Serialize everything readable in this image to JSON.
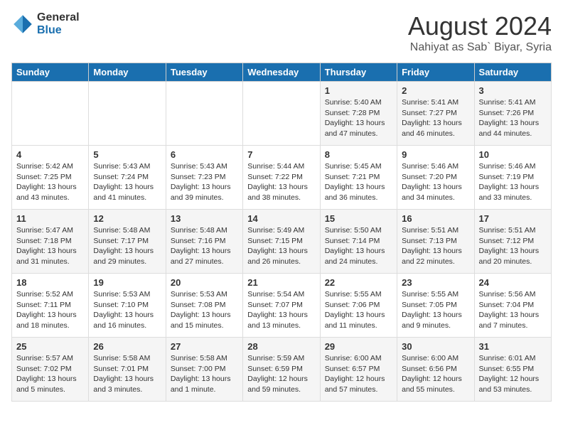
{
  "header": {
    "logo_general": "General",
    "logo_blue": "Blue",
    "month_title": "August 2024",
    "location": "Nahiyat as Sab` Biyar, Syria"
  },
  "weekdays": [
    "Sunday",
    "Monday",
    "Tuesday",
    "Wednesday",
    "Thursday",
    "Friday",
    "Saturday"
  ],
  "weeks": [
    [
      {
        "day": "",
        "info": ""
      },
      {
        "day": "",
        "info": ""
      },
      {
        "day": "",
        "info": ""
      },
      {
        "day": "",
        "info": ""
      },
      {
        "day": "1",
        "info": "Sunrise: 5:40 AM\nSunset: 7:28 PM\nDaylight: 13 hours\nand 47 minutes."
      },
      {
        "day": "2",
        "info": "Sunrise: 5:41 AM\nSunset: 7:27 PM\nDaylight: 13 hours\nand 46 minutes."
      },
      {
        "day": "3",
        "info": "Sunrise: 5:41 AM\nSunset: 7:26 PM\nDaylight: 13 hours\nand 44 minutes."
      }
    ],
    [
      {
        "day": "4",
        "info": "Sunrise: 5:42 AM\nSunset: 7:25 PM\nDaylight: 13 hours\nand 43 minutes."
      },
      {
        "day": "5",
        "info": "Sunrise: 5:43 AM\nSunset: 7:24 PM\nDaylight: 13 hours\nand 41 minutes."
      },
      {
        "day": "6",
        "info": "Sunrise: 5:43 AM\nSunset: 7:23 PM\nDaylight: 13 hours\nand 39 minutes."
      },
      {
        "day": "7",
        "info": "Sunrise: 5:44 AM\nSunset: 7:22 PM\nDaylight: 13 hours\nand 38 minutes."
      },
      {
        "day": "8",
        "info": "Sunrise: 5:45 AM\nSunset: 7:21 PM\nDaylight: 13 hours\nand 36 minutes."
      },
      {
        "day": "9",
        "info": "Sunrise: 5:46 AM\nSunset: 7:20 PM\nDaylight: 13 hours\nand 34 minutes."
      },
      {
        "day": "10",
        "info": "Sunrise: 5:46 AM\nSunset: 7:19 PM\nDaylight: 13 hours\nand 33 minutes."
      }
    ],
    [
      {
        "day": "11",
        "info": "Sunrise: 5:47 AM\nSunset: 7:18 PM\nDaylight: 13 hours\nand 31 minutes."
      },
      {
        "day": "12",
        "info": "Sunrise: 5:48 AM\nSunset: 7:17 PM\nDaylight: 13 hours\nand 29 minutes."
      },
      {
        "day": "13",
        "info": "Sunrise: 5:48 AM\nSunset: 7:16 PM\nDaylight: 13 hours\nand 27 minutes."
      },
      {
        "day": "14",
        "info": "Sunrise: 5:49 AM\nSunset: 7:15 PM\nDaylight: 13 hours\nand 26 minutes."
      },
      {
        "day": "15",
        "info": "Sunrise: 5:50 AM\nSunset: 7:14 PM\nDaylight: 13 hours\nand 24 minutes."
      },
      {
        "day": "16",
        "info": "Sunrise: 5:51 AM\nSunset: 7:13 PM\nDaylight: 13 hours\nand 22 minutes."
      },
      {
        "day": "17",
        "info": "Sunrise: 5:51 AM\nSunset: 7:12 PM\nDaylight: 13 hours\nand 20 minutes."
      }
    ],
    [
      {
        "day": "18",
        "info": "Sunrise: 5:52 AM\nSunset: 7:11 PM\nDaylight: 13 hours\nand 18 minutes."
      },
      {
        "day": "19",
        "info": "Sunrise: 5:53 AM\nSunset: 7:10 PM\nDaylight: 13 hours\nand 16 minutes."
      },
      {
        "day": "20",
        "info": "Sunrise: 5:53 AM\nSunset: 7:08 PM\nDaylight: 13 hours\nand 15 minutes."
      },
      {
        "day": "21",
        "info": "Sunrise: 5:54 AM\nSunset: 7:07 PM\nDaylight: 13 hours\nand 13 minutes."
      },
      {
        "day": "22",
        "info": "Sunrise: 5:55 AM\nSunset: 7:06 PM\nDaylight: 13 hours\nand 11 minutes."
      },
      {
        "day": "23",
        "info": "Sunrise: 5:55 AM\nSunset: 7:05 PM\nDaylight: 13 hours\nand 9 minutes."
      },
      {
        "day": "24",
        "info": "Sunrise: 5:56 AM\nSunset: 7:04 PM\nDaylight: 13 hours\nand 7 minutes."
      }
    ],
    [
      {
        "day": "25",
        "info": "Sunrise: 5:57 AM\nSunset: 7:02 PM\nDaylight: 13 hours\nand 5 minutes."
      },
      {
        "day": "26",
        "info": "Sunrise: 5:58 AM\nSunset: 7:01 PM\nDaylight: 13 hours\nand 3 minutes."
      },
      {
        "day": "27",
        "info": "Sunrise: 5:58 AM\nSunset: 7:00 PM\nDaylight: 13 hours\nand 1 minute."
      },
      {
        "day": "28",
        "info": "Sunrise: 5:59 AM\nSunset: 6:59 PM\nDaylight: 12 hours\nand 59 minutes."
      },
      {
        "day": "29",
        "info": "Sunrise: 6:00 AM\nSunset: 6:57 PM\nDaylight: 12 hours\nand 57 minutes."
      },
      {
        "day": "30",
        "info": "Sunrise: 6:00 AM\nSunset: 6:56 PM\nDaylight: 12 hours\nand 55 minutes."
      },
      {
        "day": "31",
        "info": "Sunrise: 6:01 AM\nSunset: 6:55 PM\nDaylight: 12 hours\nand 53 minutes."
      }
    ]
  ]
}
